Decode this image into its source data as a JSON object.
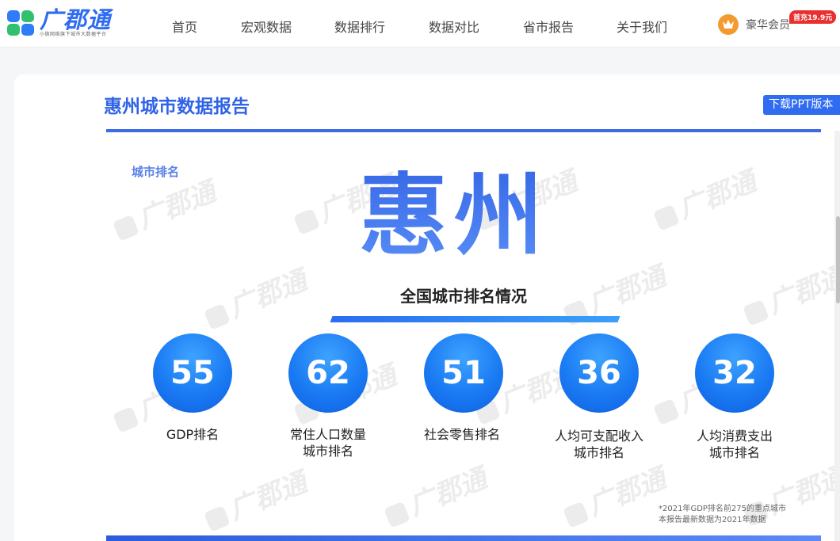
{
  "header": {
    "logo": {
      "name": "广郡通",
      "tagline": "小微网络旗下城市大数据平台"
    },
    "nav": [
      "首页",
      "宏观数据",
      "数据排行",
      "数据对比",
      "省市报告",
      "关于我们"
    ],
    "vip": {
      "label": "豪华会员",
      "badge": "首充19.9元",
      "icon": "crown-icon"
    }
  },
  "report": {
    "title": "惠州城市数据报告",
    "download_label": "下载PPT版本"
  },
  "slide": {
    "section_label": "城市排名",
    "city": "惠州",
    "subtitle": "全国城市排名情况",
    "watermark": "广郡通",
    "rankings": [
      {
        "value": "55",
        "label": [
          "GDP排名"
        ]
      },
      {
        "value": "62",
        "label": [
          "常住人口数量",
          "城市排名"
        ]
      },
      {
        "value": "51",
        "label": [
          "社会零售排名"
        ]
      },
      {
        "value": "36",
        "label": [
          "人均可支配收入",
          "城市排名"
        ]
      },
      {
        "value": "32",
        "label": [
          "人均消费支出",
          "城市排名"
        ]
      }
    ],
    "footnote": [
      "*2021年GDP排名前275的重点城市",
      "本报告最新数据为2021年数据"
    ]
  },
  "colors": {
    "accent": "#2f6cf0",
    "title": "#3063e6",
    "circle": "#1a7af3",
    "badge": "#e9302e",
    "vip": "#f39b2f"
  }
}
